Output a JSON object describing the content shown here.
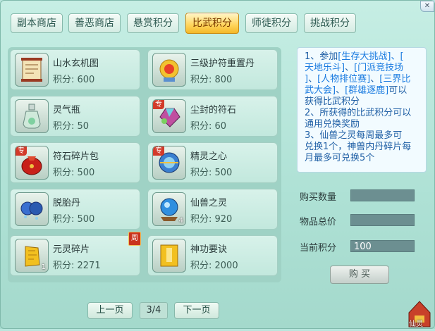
{
  "tabs": [
    {
      "label": "副本商店",
      "active": false
    },
    {
      "label": "善恶商店",
      "active": false
    },
    {
      "label": "悬赏积分",
      "active": false
    },
    {
      "label": "比武积分",
      "active": true
    },
    {
      "label": "师徒积分",
      "active": false
    },
    {
      "label": "挑战积分",
      "active": false
    }
  ],
  "items": [
    {
      "name": "山水玄机图",
      "price": "积分: 600",
      "icon": "scroll-map-icon",
      "badge": "",
      "count": ""
    },
    {
      "name": "三级护符重置丹",
      "price": "积分: 800",
      "icon": "golden-pill-icon",
      "badge": "",
      "count": ""
    },
    {
      "name": "灵气瓶",
      "price": "积分: 50",
      "icon": "bottle-icon",
      "badge": "",
      "count": ""
    },
    {
      "name": "尘封的符石",
      "price": "积分: 60",
      "icon": "gem-stone-icon",
      "badge": "专",
      "count": ""
    },
    {
      "name": "符石碎片包",
      "price": "积分: 500",
      "icon": "red-bag-icon",
      "badge": "专",
      "count": ""
    },
    {
      "name": "精灵之心",
      "price": "积分: 500",
      "icon": "spirit-heart-icon",
      "badge": "专",
      "count": ""
    },
    {
      "name": "脱胎丹",
      "price": "积分: 500",
      "icon": "blue-pill-icon",
      "badge": "",
      "count": ""
    },
    {
      "name": "仙兽之灵",
      "price": "积分: 920",
      "icon": "beast-orb-icon",
      "badge": "",
      "count": "4"
    },
    {
      "name": "元灵碎片",
      "price": "积分: 2271",
      "icon": "gold-shard-icon",
      "badge": "",
      "count": "1",
      "week": "周"
    },
    {
      "name": "神功要诀",
      "price": "积分: 2000",
      "icon": "book-icon",
      "badge": "",
      "count": ""
    }
  ],
  "info": {
    "l1a": "1、参加",
    "l1b": "[生存大挑战]",
    "l1c": "、[",
    "l2a": "天地乐斗]",
    "l2b": "、",
    "l2c": "[门派竞技场",
    "l3a": "]",
    "l3b": "、",
    "l3c": "[人物排位赛]",
    "l3d": "、",
    "l3e": "[三界比",
    "l4a": "武大会]",
    "l4b": "、",
    "l4c": "[群雄逐鹿]",
    "l4d": "可以",
    "l5": "获得比武积分",
    "l6": "2、所获得的比武积分可以",
    "l7": "通用兑换奖励",
    "l8": "3、仙兽之灵每周最多可",
    "l9": "兑换1个，神兽内丹碎片每",
    "l10": "月最多可兑换5个"
  },
  "form": {
    "qty_label": "购买数量",
    "qty_value": "",
    "total_label": "物品总价",
    "total_value": "",
    "current_label": "当前积分",
    "current_value": "100",
    "buy_label": "购 买"
  },
  "pagination": {
    "prev": "上一页",
    "indicator": "3/4",
    "next": "下一页"
  },
  "corner_label": "仙灵"
}
